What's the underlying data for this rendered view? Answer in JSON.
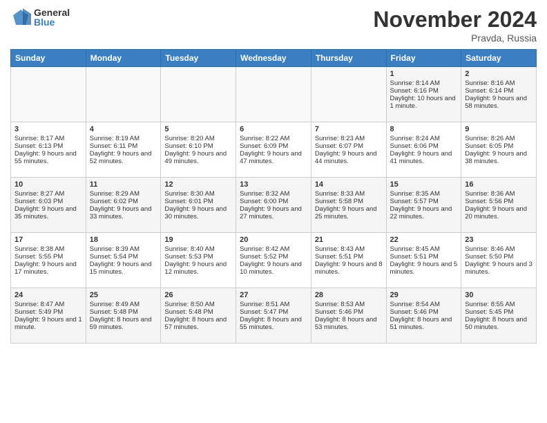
{
  "logo": {
    "general": "General",
    "blue": "Blue"
  },
  "title": "November 2024",
  "location": "Pravda, Russia",
  "days_of_week": [
    "Sunday",
    "Monday",
    "Tuesday",
    "Wednesday",
    "Thursday",
    "Friday",
    "Saturday"
  ],
  "weeks": [
    [
      {
        "day": "",
        "info": ""
      },
      {
        "day": "",
        "info": ""
      },
      {
        "day": "",
        "info": ""
      },
      {
        "day": "",
        "info": ""
      },
      {
        "day": "",
        "info": ""
      },
      {
        "day": "1",
        "info": "Sunrise: 8:14 AM\nSunset: 6:16 PM\nDaylight: 10 hours and 1 minute."
      },
      {
        "day": "2",
        "info": "Sunrise: 8:16 AM\nSunset: 6:14 PM\nDaylight: 9 hours and 58 minutes."
      }
    ],
    [
      {
        "day": "3",
        "info": "Sunrise: 8:17 AM\nSunset: 6:13 PM\nDaylight: 9 hours and 55 minutes."
      },
      {
        "day": "4",
        "info": "Sunrise: 8:19 AM\nSunset: 6:11 PM\nDaylight: 9 hours and 52 minutes."
      },
      {
        "day": "5",
        "info": "Sunrise: 8:20 AM\nSunset: 6:10 PM\nDaylight: 9 hours and 49 minutes."
      },
      {
        "day": "6",
        "info": "Sunrise: 8:22 AM\nSunset: 6:09 PM\nDaylight: 9 hours and 47 minutes."
      },
      {
        "day": "7",
        "info": "Sunrise: 8:23 AM\nSunset: 6:07 PM\nDaylight: 9 hours and 44 minutes."
      },
      {
        "day": "8",
        "info": "Sunrise: 8:24 AM\nSunset: 6:06 PM\nDaylight: 9 hours and 41 minutes."
      },
      {
        "day": "9",
        "info": "Sunrise: 8:26 AM\nSunset: 6:05 PM\nDaylight: 9 hours and 38 minutes."
      }
    ],
    [
      {
        "day": "10",
        "info": "Sunrise: 8:27 AM\nSunset: 6:03 PM\nDaylight: 9 hours and 35 minutes."
      },
      {
        "day": "11",
        "info": "Sunrise: 8:29 AM\nSunset: 6:02 PM\nDaylight: 9 hours and 33 minutes."
      },
      {
        "day": "12",
        "info": "Sunrise: 8:30 AM\nSunset: 6:01 PM\nDaylight: 9 hours and 30 minutes."
      },
      {
        "day": "13",
        "info": "Sunrise: 8:32 AM\nSunset: 6:00 PM\nDaylight: 9 hours and 27 minutes."
      },
      {
        "day": "14",
        "info": "Sunrise: 8:33 AM\nSunset: 5:58 PM\nDaylight: 9 hours and 25 minutes."
      },
      {
        "day": "15",
        "info": "Sunrise: 8:35 AM\nSunset: 5:57 PM\nDaylight: 9 hours and 22 minutes."
      },
      {
        "day": "16",
        "info": "Sunrise: 8:36 AM\nSunset: 5:56 PM\nDaylight: 9 hours and 20 minutes."
      }
    ],
    [
      {
        "day": "17",
        "info": "Sunrise: 8:38 AM\nSunset: 5:55 PM\nDaylight: 9 hours and 17 minutes."
      },
      {
        "day": "18",
        "info": "Sunrise: 8:39 AM\nSunset: 5:54 PM\nDaylight: 9 hours and 15 minutes."
      },
      {
        "day": "19",
        "info": "Sunrise: 8:40 AM\nSunset: 5:53 PM\nDaylight: 9 hours and 12 minutes."
      },
      {
        "day": "20",
        "info": "Sunrise: 8:42 AM\nSunset: 5:52 PM\nDaylight: 9 hours and 10 minutes."
      },
      {
        "day": "21",
        "info": "Sunrise: 8:43 AM\nSunset: 5:51 PM\nDaylight: 9 hours and 8 minutes."
      },
      {
        "day": "22",
        "info": "Sunrise: 8:45 AM\nSunset: 5:51 PM\nDaylight: 9 hours and 5 minutes."
      },
      {
        "day": "23",
        "info": "Sunrise: 8:46 AM\nSunset: 5:50 PM\nDaylight: 9 hours and 3 minutes."
      }
    ],
    [
      {
        "day": "24",
        "info": "Sunrise: 8:47 AM\nSunset: 5:49 PM\nDaylight: 9 hours and 1 minute."
      },
      {
        "day": "25",
        "info": "Sunrise: 8:49 AM\nSunset: 5:48 PM\nDaylight: 8 hours and 59 minutes."
      },
      {
        "day": "26",
        "info": "Sunrise: 8:50 AM\nSunset: 5:48 PM\nDaylight: 8 hours and 57 minutes."
      },
      {
        "day": "27",
        "info": "Sunrise: 8:51 AM\nSunset: 5:47 PM\nDaylight: 8 hours and 55 minutes."
      },
      {
        "day": "28",
        "info": "Sunrise: 8:53 AM\nSunset: 5:46 PM\nDaylight: 8 hours and 53 minutes."
      },
      {
        "day": "29",
        "info": "Sunrise: 8:54 AM\nSunset: 5:46 PM\nDaylight: 8 hours and 51 minutes."
      },
      {
        "day": "30",
        "info": "Sunrise: 8:55 AM\nSunset: 5:45 PM\nDaylight: 8 hours and 50 minutes."
      }
    ]
  ]
}
